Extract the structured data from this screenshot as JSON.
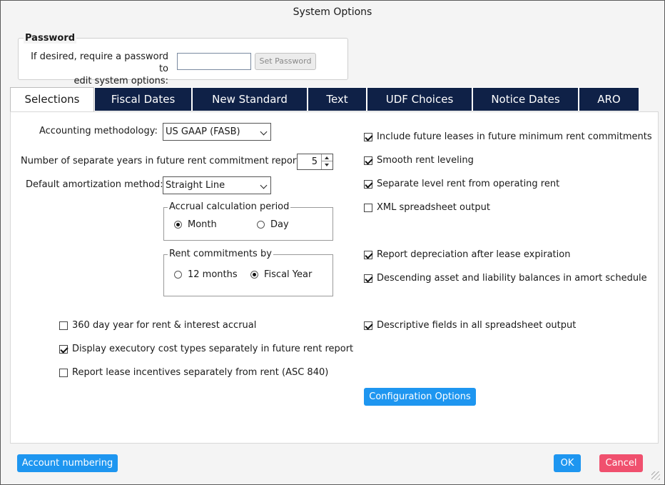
{
  "window": {
    "title": "System Options"
  },
  "password": {
    "legend": "Password",
    "label_line1": "If desired, require a password to",
    "label_line2": "edit system options:",
    "input_value": "",
    "button_label": "Set Password"
  },
  "tabs": [
    {
      "label": "Selections",
      "active": true
    },
    {
      "label": "Fiscal Dates",
      "active": false
    },
    {
      "label": "New Standard",
      "active": false
    },
    {
      "label": "Text",
      "active": false
    },
    {
      "label": "UDF Choices",
      "active": false
    },
    {
      "label": "Notice Dates",
      "active": false
    },
    {
      "label": "ARO",
      "active": false
    }
  ],
  "selections": {
    "accounting_label": "Accounting methodology:",
    "accounting_value": "US GAAP (FASB)",
    "years_label": "Number of separate years in future rent commitment report:",
    "years_value": "5",
    "amort_label": "Default amortization method:",
    "amort_value": "Straight Line",
    "accrual": {
      "legend": "Accrual calculation period",
      "option1": "Month",
      "option2": "Day",
      "selected": "Month"
    },
    "rent_commit": {
      "legend": "Rent commitments by",
      "option1": "12 months",
      "option2": "Fiscal Year",
      "selected": "Fiscal Year"
    },
    "right_checks": [
      {
        "label": "Include future leases in future minimum rent commitments",
        "checked": true
      },
      {
        "label": "Smooth rent leveling",
        "checked": true
      },
      {
        "label": "Separate level rent from operating rent",
        "checked": true
      },
      {
        "label": "XML spreadsheet output",
        "checked": false
      },
      {
        "label": "Report depreciation after lease expiration",
        "checked": true
      },
      {
        "label": "Descending asset and liability balances in amort schedule",
        "checked": true
      },
      {
        "label": "Descriptive fields in all spreadsheet output",
        "checked": true
      }
    ],
    "left_checks": [
      {
        "label": "360 day year for rent & interest accrual",
        "checked": false
      },
      {
        "label": "Display executory cost types separately in future rent report",
        "checked": true
      },
      {
        "label": "Report lease incentives separately from rent (ASC 840)",
        "checked": false
      }
    ],
    "config_button": "Configuration Options"
  },
  "footer": {
    "account_button": "Account numbering",
    "ok_button": "OK",
    "cancel_button": "Cancel"
  },
  "colors": {
    "tab_bg": "#0f2147",
    "primary_button": "#1e96f0",
    "cancel_button": "#f0506e"
  }
}
